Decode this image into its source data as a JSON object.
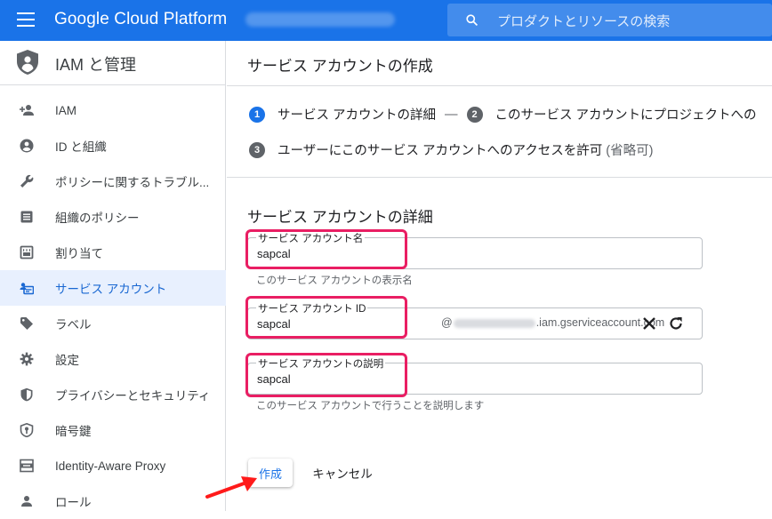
{
  "topbar": {
    "brand": "Google Cloud Platform",
    "search_placeholder": "プロダクトとリソースの検索",
    "color": "#1a73e8"
  },
  "sidebar": {
    "title": "IAM と管理",
    "items": [
      {
        "label": "IAM",
        "icon": "person-add-icon"
      },
      {
        "label": "ID と組織",
        "icon": "account-circle-icon"
      },
      {
        "label": "ポリシーに関するトラブル...",
        "icon": "wrench-icon"
      },
      {
        "label": "組織のポリシー",
        "icon": "list-alt-icon"
      },
      {
        "label": "割り当て",
        "icon": "quota-icon"
      },
      {
        "label": "サービス アカウント",
        "icon": "service-account-icon",
        "active": true
      },
      {
        "label": "ラベル",
        "icon": "label-icon"
      },
      {
        "label": "設定",
        "icon": "gear-icon"
      },
      {
        "label": "プライバシーとセキュリティ",
        "icon": "shield-icon"
      },
      {
        "label": "暗号鍵",
        "icon": "key-shield-icon"
      },
      {
        "label": "Identity-Aware Proxy",
        "icon": "proxy-icon"
      },
      {
        "label": "ロール",
        "icon": "roles-icon"
      }
    ]
  },
  "main": {
    "page_title": "サービス アカウントの作成",
    "steps": [
      {
        "num": "1",
        "label": "サービス アカウントの詳細",
        "active": true
      },
      {
        "num": "2",
        "label": "このサービス アカウントにプロジェクトへの"
      },
      {
        "num": "3",
        "label": "ユーザーにこのサービス アカウントへのアクセスを許可",
        "optional": "(省略可)"
      }
    ],
    "step_separator": "—",
    "section_title": "サービス アカウントの詳細",
    "fields": {
      "name": {
        "label": "サービス アカウント名",
        "value": "sapcal",
        "helper": "このサービス アカウントの表示名"
      },
      "id": {
        "label": "サービス アカウント ID",
        "value": "sapcal",
        "suffix_prefix": "@",
        "suffix_domain": ".iam.gserviceaccount.com"
      },
      "description": {
        "label": "サービス アカウントの説明",
        "value": "sapcal",
        "helper": "このサービス アカウントで行うことを説明します"
      }
    },
    "buttons": {
      "create": "作成",
      "cancel": "キャンセル"
    }
  },
  "annotation_color": "#e91e63"
}
